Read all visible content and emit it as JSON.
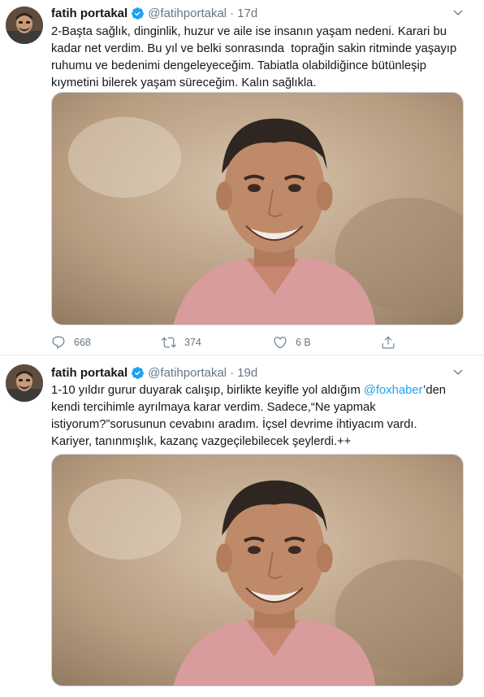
{
  "tweets": [
    {
      "display_name": "fatih portakal",
      "handle": "@fatihportakal",
      "separator": "·",
      "time": "17d",
      "text": "2-Başta sağlık, dinginlik, huzur ve aile ise insanın yaşam nedeni. Karari bu kadar net verdim. Bu yıl ve belki sonrasında  toprağin sakin ritminde yaşayıp ruhumu ve bedenimi dengeleyeceğim. Tabiatla olabildiğince bütünleşip kıymetini bilerek yaşam süreceğim. Kalın sağlıkla.",
      "reply_count": "668",
      "retweet_count": "374",
      "like_count": "6 B"
    },
    {
      "display_name": "fatih portakal",
      "handle": "@fatihportakal",
      "separator": "·",
      "time": "19d",
      "text_before": "1-10 yıldır gurur duyarak calışıp, birlikte keyifle yol aldığım ",
      "mention": "@foxhaber",
      "text_after": "’den kendi tercihimle ayrılmaya karar verdim. Sadece,“Ne yapmak istiyorum?”sorusunun cevabını aradım. İçsel devrime ihtiyacım vardı. Kariyer, tanınmışlık, kazanç vazgeçilebilecek şeylerdi.++"
    }
  ],
  "colors": {
    "text": "#14171a",
    "secondary": "#657786",
    "link": "#1da1f2",
    "verified": "#1da1f2",
    "divider": "#e6ecf0"
  },
  "icons": {
    "verified": "verified-badge-icon",
    "caret": "chevron-down-icon",
    "reply": "reply-icon",
    "retweet": "retweet-icon",
    "like": "heart-icon",
    "share": "share-icon"
  }
}
